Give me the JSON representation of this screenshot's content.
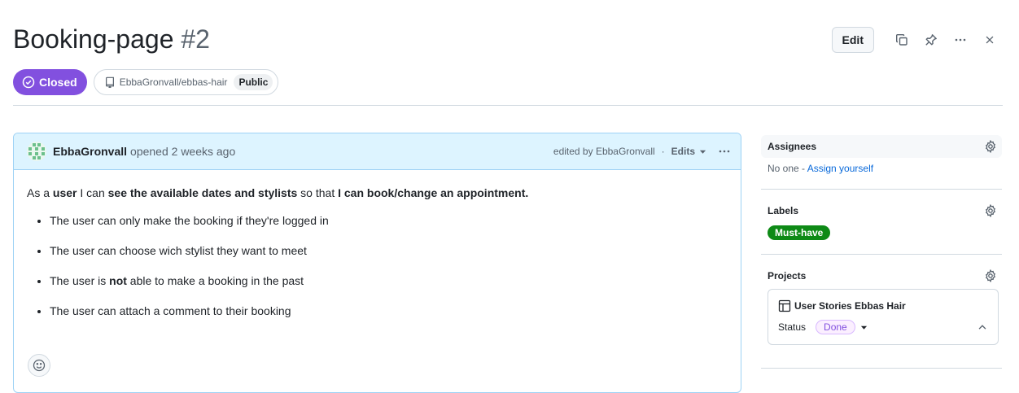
{
  "issue": {
    "title": "Booking-page",
    "number": "#2",
    "state_label": "Closed",
    "repo": "EbbaGronvall/ebbas-hair",
    "visibility": "Public"
  },
  "header": {
    "edit_label": "Edit"
  },
  "comment": {
    "author": "EbbaGronvall",
    "opened_text": "opened 2 weeks ago",
    "edited_by": "edited by EbbaGronvall",
    "separator": "·",
    "edits_label": "Edits",
    "intro": {
      "p1": "As a ",
      "b1": "user",
      "p2": " I can ",
      "b2": "see the available dates and stylists",
      "p3": " so that ",
      "b3": "I can book/change an appointment."
    },
    "items": {
      "i1": "The user can only make the booking if they're logged in",
      "i2": "The user can choose wich stylist they want to meet",
      "i3a": "The user is ",
      "i3b": "not",
      "i3c": " able to make a booking in the past",
      "i4": "The user can attach a comment to their booking"
    }
  },
  "sidebar": {
    "assignees": {
      "title": "Assignees",
      "none": "No one - ",
      "assign_link": "Assign yourself"
    },
    "labels": {
      "title": "Labels",
      "label": "Must-have",
      "label_color": "#0e8a16"
    },
    "projects": {
      "title": "Projects",
      "project_name": "User Stories Ebbas Hair",
      "status_key": "Status",
      "status_value": "Done"
    }
  },
  "colors": {
    "closed": "#8250df",
    "link": "#0969da",
    "comment_header": "#ddf4ff"
  },
  "icons": [
    "issue-closed-icon",
    "repo-icon",
    "copy-icon",
    "pin-icon",
    "kebab-icon",
    "close-icon",
    "gear-icon",
    "smiley-icon",
    "table-icon",
    "caret-down-icon",
    "chevron-up-icon"
  ]
}
